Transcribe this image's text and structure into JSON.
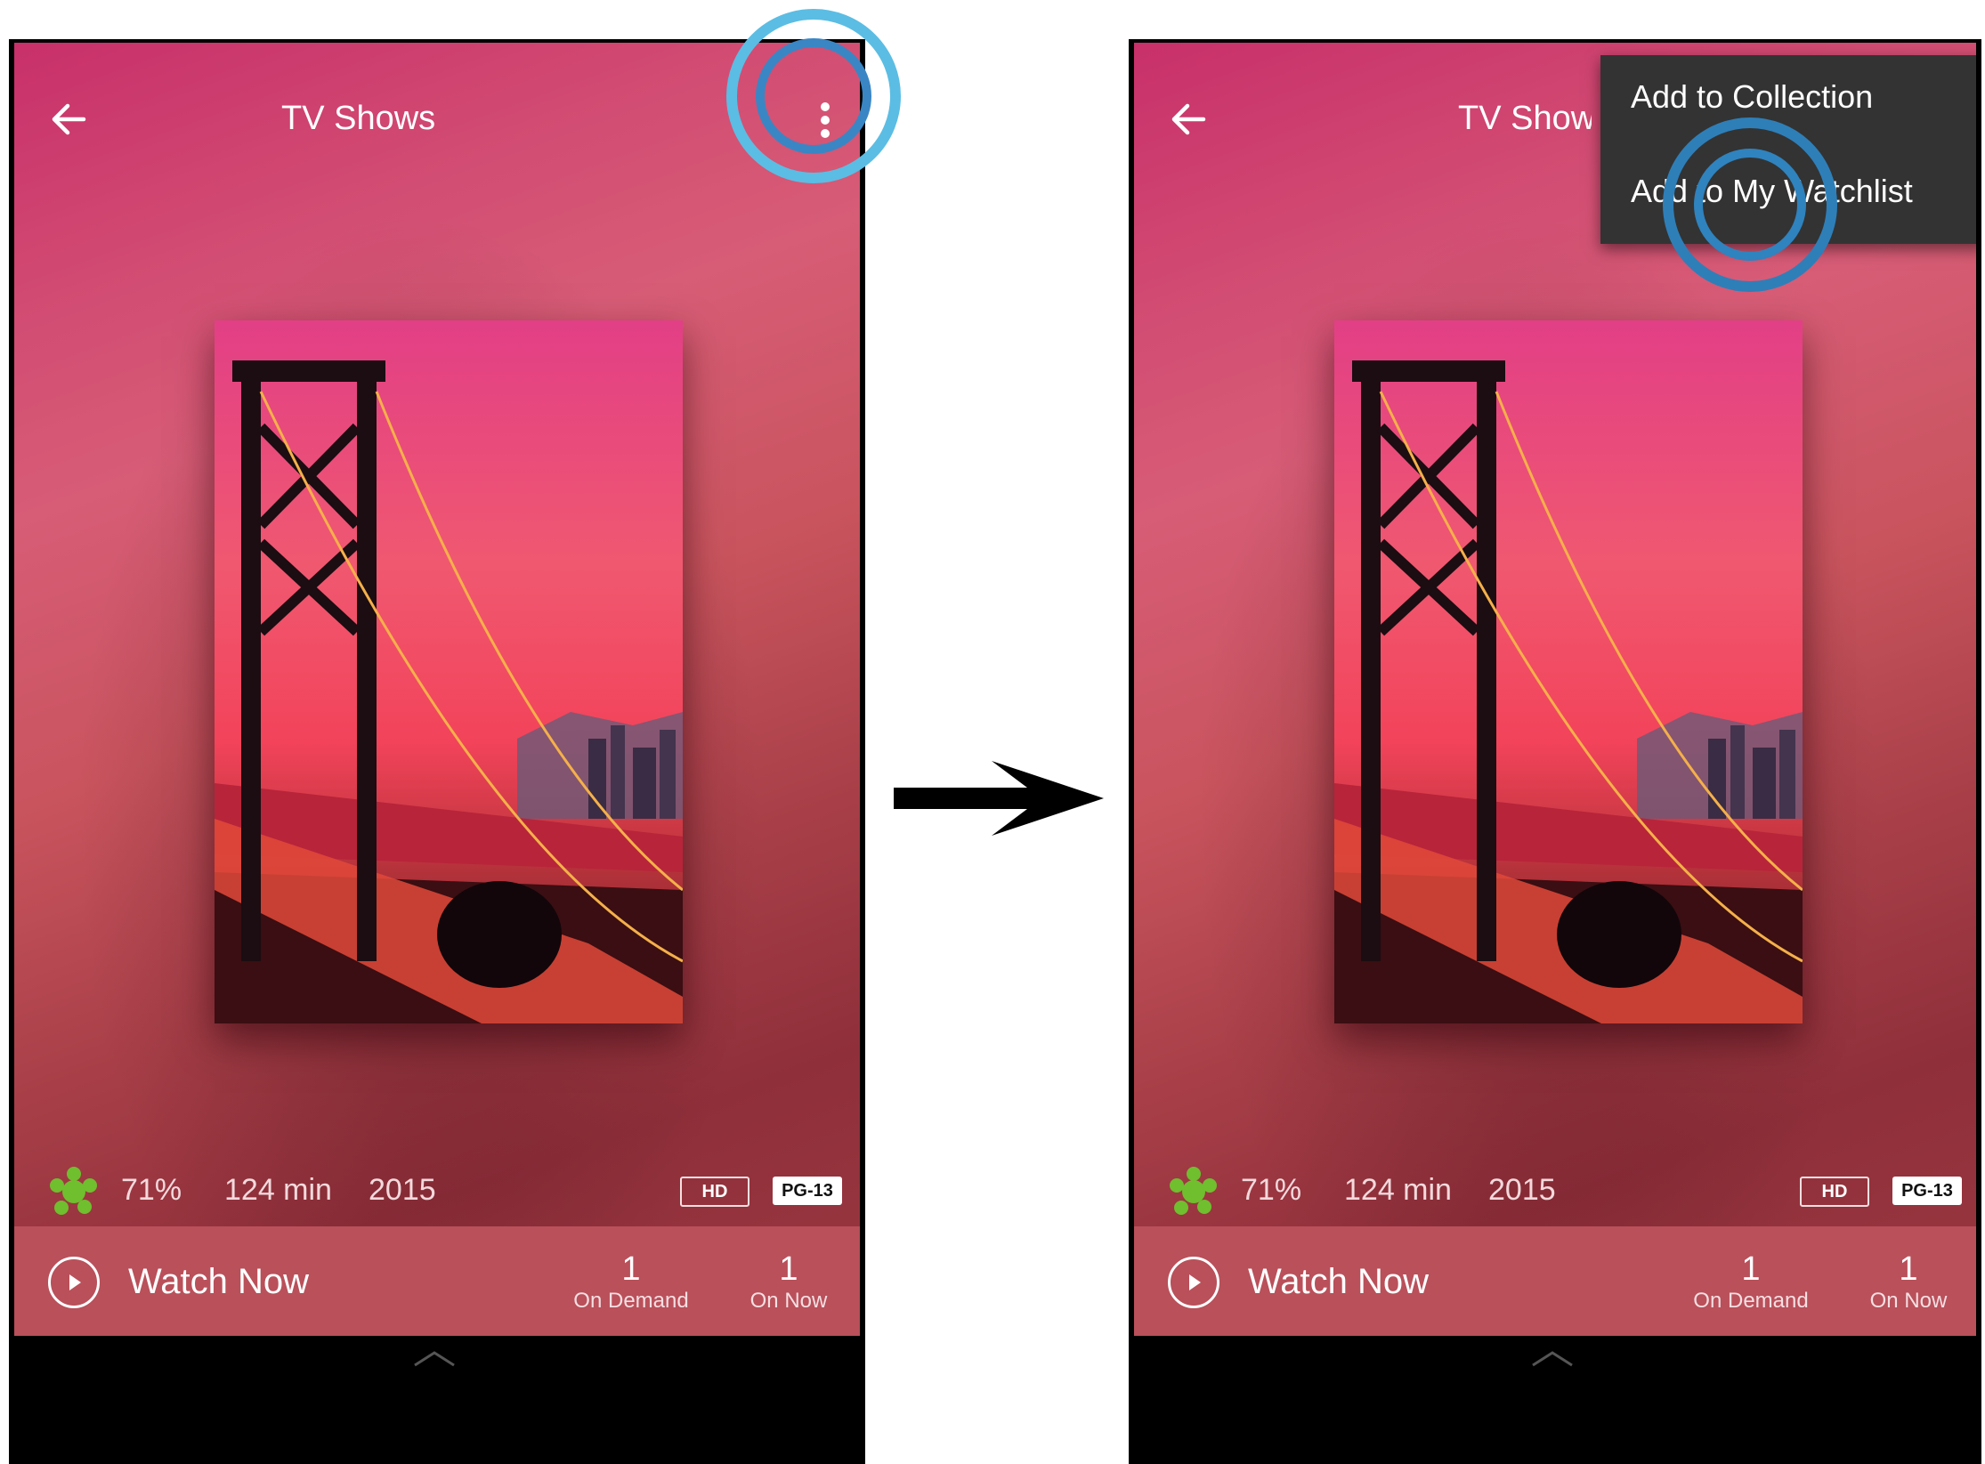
{
  "screens": {
    "left": {
      "appbar": {
        "title": "TV Shows",
        "back_icon": "arrow-left-icon",
        "overflow_icon": "more-vert-icon"
      },
      "meta": {
        "score": "71%",
        "runtime": "124 min",
        "year": "2015",
        "hd_badge": "HD",
        "rating_badge": "PG-13"
      },
      "watchbar": {
        "label": "Watch Now",
        "on_demand_count": "1",
        "on_demand_label": "On Demand",
        "on_now_count": "1",
        "on_now_label": "On Now"
      }
    },
    "right": {
      "appbar": {
        "title": "TV Shows",
        "back_icon": "arrow-left-icon"
      },
      "menu": {
        "items": [
          {
            "label": "Add to Collection"
          },
          {
            "label": "Add to My Watchlist"
          }
        ]
      },
      "meta": {
        "score": "71%",
        "runtime": "124 min",
        "year": "2015",
        "hd_badge": "HD",
        "rating_badge": "PG-13"
      },
      "watchbar": {
        "label": "Watch Now",
        "on_demand_count": "1",
        "on_demand_label": "On Demand",
        "on_now_count": "1",
        "on_now_label": "On Now"
      }
    }
  },
  "colors": {
    "highlight_ring": "#5bbde3",
    "menu_bg": "#333333",
    "watchbar_bg": "#b9505a",
    "score_icon": "#6fbf2e"
  }
}
